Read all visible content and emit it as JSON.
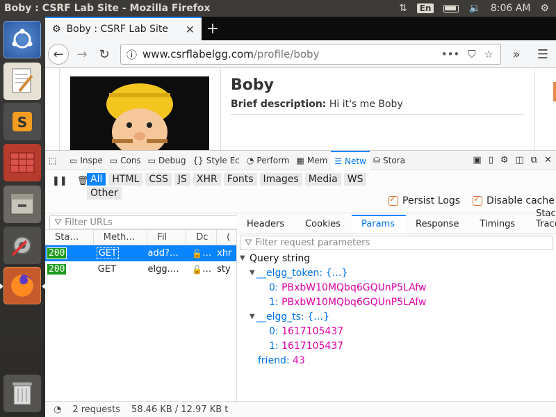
{
  "system": {
    "window_title": "Boby : CSRF Lab Site - Mozilla Firefox",
    "keyboard_layout": "En",
    "clock": "8:06 AM"
  },
  "launcher": {
    "items": [
      "ubuntu-dash",
      "text-editor",
      "sublime-text",
      "spreadsheet",
      "files",
      "system-settings",
      "firefox",
      "trash"
    ]
  },
  "browser": {
    "tab_title": "Boby : CSRF Lab Site",
    "url_host": "www.csrflabelgg.com",
    "url_path": "/profile/boby"
  },
  "page": {
    "name": "Boby",
    "desc_label": "Brief description:",
    "desc_value": "Hi it's me Boby"
  },
  "devtools": {
    "tabs": [
      "Inspector",
      "Console",
      "Debugger",
      "Style Editor",
      "Performance",
      "Memory",
      "Network",
      "Storage"
    ],
    "tab_short": [
      "Inspe",
      "Cons",
      "Debug",
      "Style Ec",
      "Perform",
      "Mem",
      "Netw",
      "Stora"
    ],
    "active_tab": "Network",
    "type_filters": [
      "All",
      "HTML",
      "CSS",
      "JS",
      "XHR",
      "Fonts",
      "Images",
      "Media",
      "WS",
      "Other"
    ],
    "persist_logs": "Persist Logs",
    "disable_cache": "Disable cache",
    "url_filter_placeholder": "Filter URLs",
    "columns": [
      "Sta…",
      "Meth…",
      "Fil",
      "Dc",
      "("
    ],
    "requests": [
      {
        "status": "200",
        "method": "GET",
        "file": "add?…",
        "domain": "…",
        "cause": "xhr"
      },
      {
        "status": "200",
        "method": "GET",
        "file": "elgg.…",
        "domain": "…",
        "cause": "sty"
      }
    ],
    "footer": {
      "requests": "2 requests",
      "size": "58.46 KB / 12.97 KB t"
    },
    "detail_tabs": [
      "Headers",
      "Cookies",
      "Params",
      "Response",
      "Timings",
      "Stack Trace"
    ],
    "active_detail_tab": "Params",
    "param_filter_placeholder": "Filter request parameters",
    "query_string_label": "Query string",
    "params": {
      "token_key": "__elgg_token: {…}",
      "token_0_key": "0:",
      "token_0_val": "PBxbW10MQbq6GQUnP5LAfw",
      "token_1_key": "1:",
      "token_1_val": "PBxbW10MQbq6GQUnP5LAfw",
      "ts_key": "__elgg_ts: {…}",
      "ts_0_key": "0:",
      "ts_0_val": "1617105437",
      "ts_1_key": "1:",
      "ts_1_val": "1617105437",
      "friend_key": "friend:",
      "friend_val": "43"
    }
  }
}
